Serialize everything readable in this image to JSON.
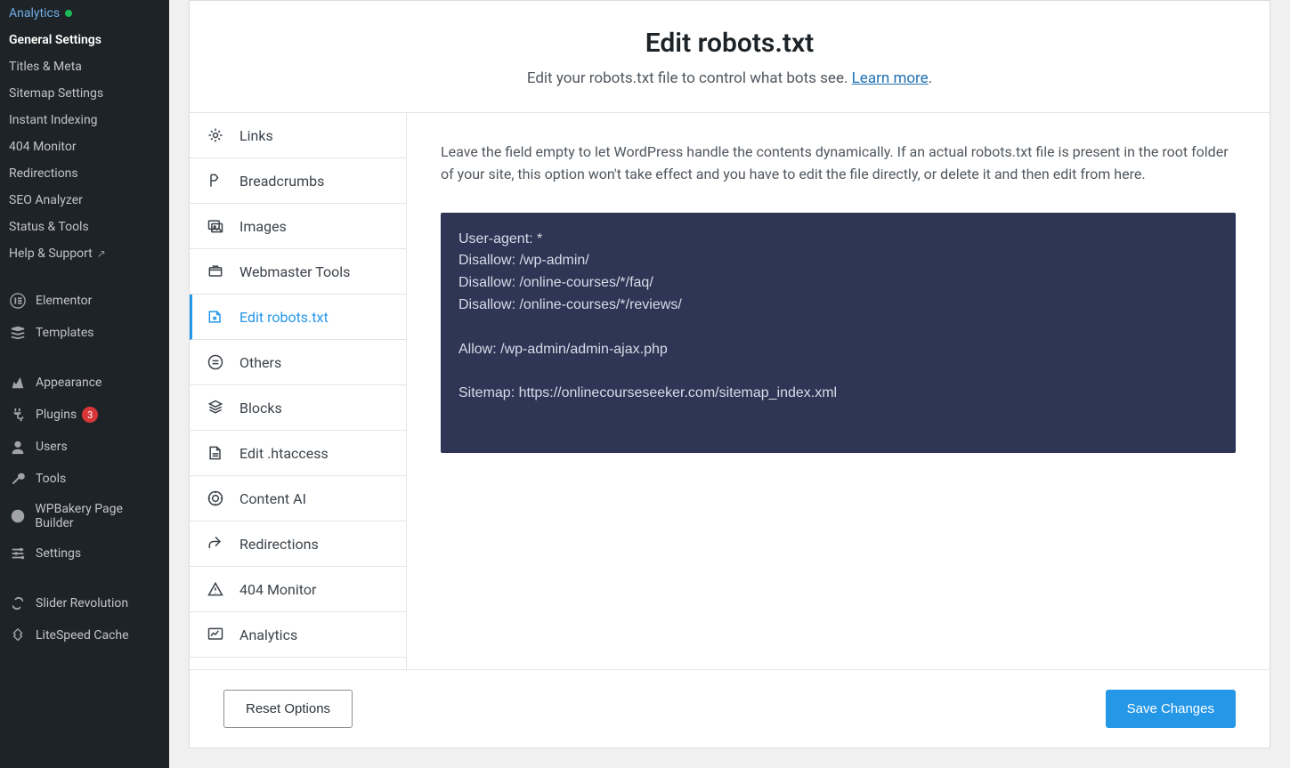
{
  "wp_sidebar": {
    "sub_items": [
      {
        "label": "Analytics",
        "dot": true
      },
      {
        "label": "General Settings",
        "active": true
      },
      {
        "label": "Titles & Meta"
      },
      {
        "label": "Sitemap Settings"
      },
      {
        "label": "Instant Indexing"
      },
      {
        "label": "404 Monitor"
      },
      {
        "label": "Redirections"
      },
      {
        "label": "SEO Analyzer"
      },
      {
        "label": "Status & Tools"
      },
      {
        "label": "Help & Support",
        "ext": true
      }
    ],
    "main_items": [
      {
        "label": "Elementor",
        "icon": "elementor"
      },
      {
        "label": "Templates",
        "icon": "templates"
      },
      {
        "label": "Appearance",
        "icon": "appearance",
        "spacer_before": true
      },
      {
        "label": "Plugins",
        "icon": "plugins",
        "badge": "3"
      },
      {
        "label": "Users",
        "icon": "users"
      },
      {
        "label": "Tools",
        "icon": "tools"
      },
      {
        "label": "WPBakery Page Builder",
        "icon": "wpbakery"
      },
      {
        "label": "Settings",
        "icon": "settings"
      },
      {
        "label": "Slider Revolution",
        "icon": "slider",
        "spacer_before": true
      },
      {
        "label": "LiteSpeed Cache",
        "icon": "litespeed"
      }
    ]
  },
  "header": {
    "title": "Edit robots.txt",
    "subtitle_pre": "Edit your robots.txt file to control what bots see. ",
    "learn_more": "Learn more"
  },
  "tabs": [
    {
      "label": "Links",
      "icon": "links"
    },
    {
      "label": "Breadcrumbs",
      "icon": "breadcrumbs"
    },
    {
      "label": "Images",
      "icon": "images"
    },
    {
      "label": "Webmaster Tools",
      "icon": "webmaster"
    },
    {
      "label": "Edit robots.txt",
      "icon": "robots",
      "active": true
    },
    {
      "label": "Others",
      "icon": "others"
    },
    {
      "label": "Blocks",
      "icon": "blocks"
    },
    {
      "label": "Edit .htaccess",
      "icon": "htaccess"
    },
    {
      "label": "Content AI",
      "icon": "contentai"
    },
    {
      "label": "Redirections",
      "icon": "redirections"
    },
    {
      "label": "404 Monitor",
      "icon": "monitor"
    },
    {
      "label": "Analytics",
      "icon": "analytics"
    }
  ],
  "content": {
    "help_text": "Leave the field empty to let WordPress handle the contents dynamically. If an actual robots.txt file is present in the root folder of your site, this option won't take effect and you have to edit the file directly, or delete it and then edit from here.",
    "robots_value": "User-agent: *\nDisallow: /wp-admin/\nDisallow: /online-courses/*/faq/\nDisallow: /online-courses/*/reviews/\n\nAllow: /wp-admin/admin-ajax.php\n\nSitemap: https://onlinecourseseeker.com/sitemap_index.xml"
  },
  "footer": {
    "reset": "Reset Options",
    "save": "Save Changes"
  }
}
